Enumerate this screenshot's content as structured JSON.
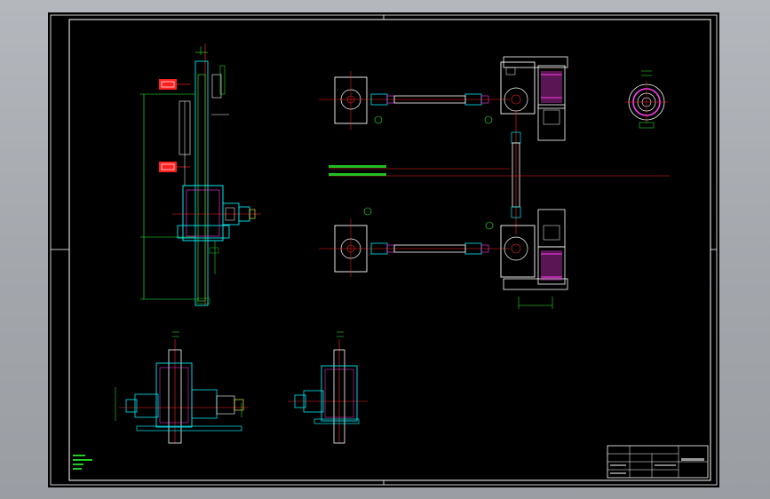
{
  "drawing": {
    "title_block_label": "",
    "annotations": [],
    "notes": []
  },
  "colors": {
    "sheet_bg": "#000000",
    "border": "#ffffff",
    "cyan": "#00e8f0",
    "red": "#ff2020",
    "green": "#2cff2c",
    "magenta": "#ff3df0",
    "yellow": "#ffff40",
    "grey": "#9a9ea3"
  },
  "icons": {
    "hex_nut": "hex-nut-icon",
    "center_mark": "center-mark-icon",
    "balloon": "balloon-icon"
  }
}
